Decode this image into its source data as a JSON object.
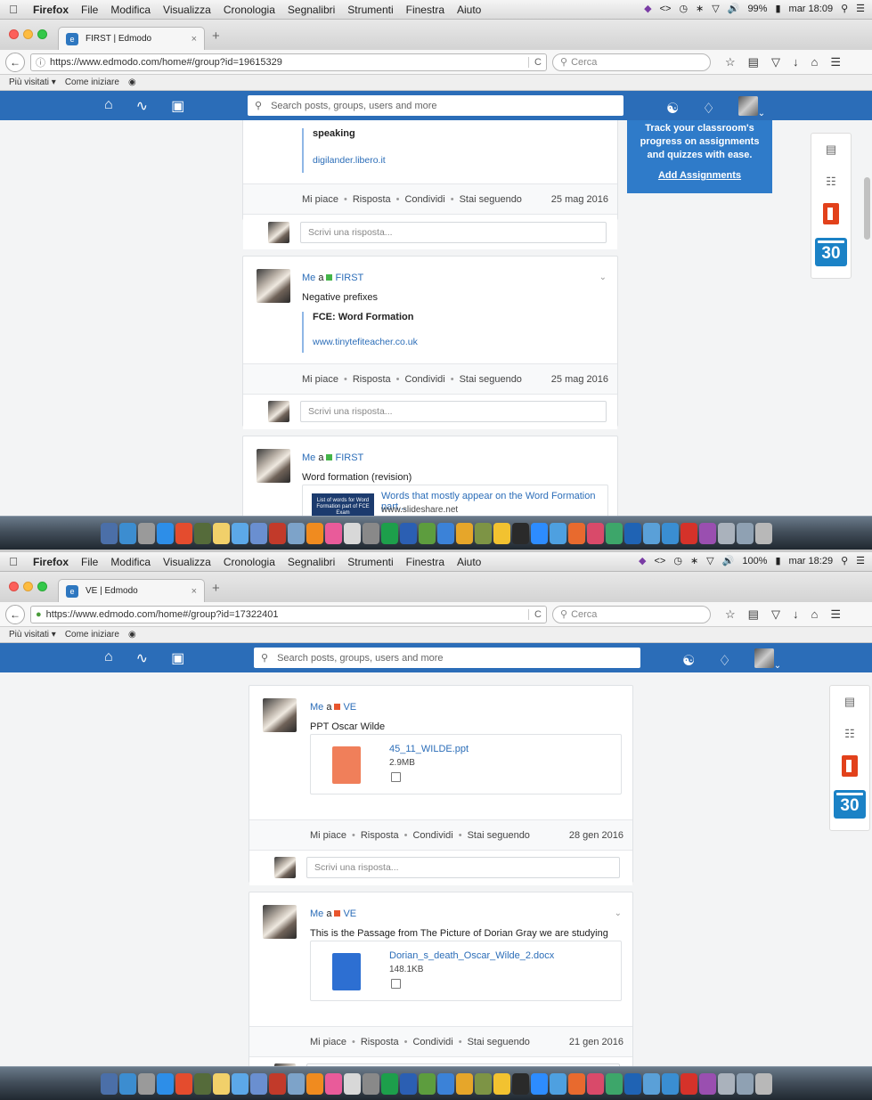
{
  "menubar": {
    "app": "Firefox",
    "items": [
      "File",
      "Modifica",
      "Visualizza",
      "Cronologia",
      "Segnalibri",
      "Strumenti",
      "Finestra",
      "Aiuto"
    ]
  },
  "browser": {
    "most_visited": "Più visitati ▾",
    "getting_started": "Come iniziare",
    "search_placeholder": "Cerca"
  },
  "edmodo": {
    "search_placeholder": "Search posts, groups, users and more",
    "reply_placeholder": "Scrivi una risposta...",
    "actions": {
      "like": "Mi piace",
      "reply": "Risposta",
      "share": "Condividi",
      "following": "Stai seguendo"
    }
  },
  "shot1": {
    "battery": "99%",
    "clock": "mar 18:09",
    "tab_title": "FIRST | Edmodo",
    "url": "https://www.edmodo.com/home#/group?id=19615329",
    "promo": {
      "text": "Track your classroom's progress on assignments and quizzes with ease.",
      "link": "Add Assignments"
    },
    "calendar_day": "30",
    "post0": {
      "link_title": "speaking",
      "link_url": "digilander.libero.it",
      "date": "25 mag 2016"
    },
    "post1": {
      "me": "Me",
      "to": "a",
      "group": "FIRST",
      "group_color": "#44b549",
      "text": "Negative prefixes",
      "link_title": "FCE: Word Formation",
      "link_url": "www.tinytefiteacher.co.uk",
      "date": "25 mag 2016"
    },
    "post2": {
      "me": "Me",
      "to": "a",
      "group": "FIRST",
      "group_color": "#44b549",
      "text": "Word formation (revision)",
      "thumb_text": "List of words for Word Formation part of FCE Exam",
      "link_title": "Words that mostly appear on the Word Formation part...",
      "link_url": "www.slideshare.net"
    }
  },
  "shot2": {
    "battery": "100%",
    "clock": "mar 18:29",
    "tab_title": "VE | Edmodo",
    "url": "https://www.edmodo.com/home#/group?id=17322401",
    "calendar_day": "30",
    "post1": {
      "me": "Me",
      "to": "a",
      "group": "VE",
      "group_color": "#e8552d",
      "text": "PPT Oscar Wilde",
      "file_name": "45_11_WILDE.ppt",
      "file_size": "2.9MB",
      "file_color": "#f07f5a",
      "date": "28 gen 2016"
    },
    "post2": {
      "me": "Me",
      "to": "a",
      "group": "VE",
      "group_color": "#e8552d",
      "text": "This is the Passage from The Picture of Dorian Gray we are studying",
      "file_name": "Dorian_s_death_Oscar_Wilde_2.docx",
      "file_size": "148.1KB",
      "file_color": "#2d6fd2",
      "date": "21 gen 2016"
    }
  }
}
